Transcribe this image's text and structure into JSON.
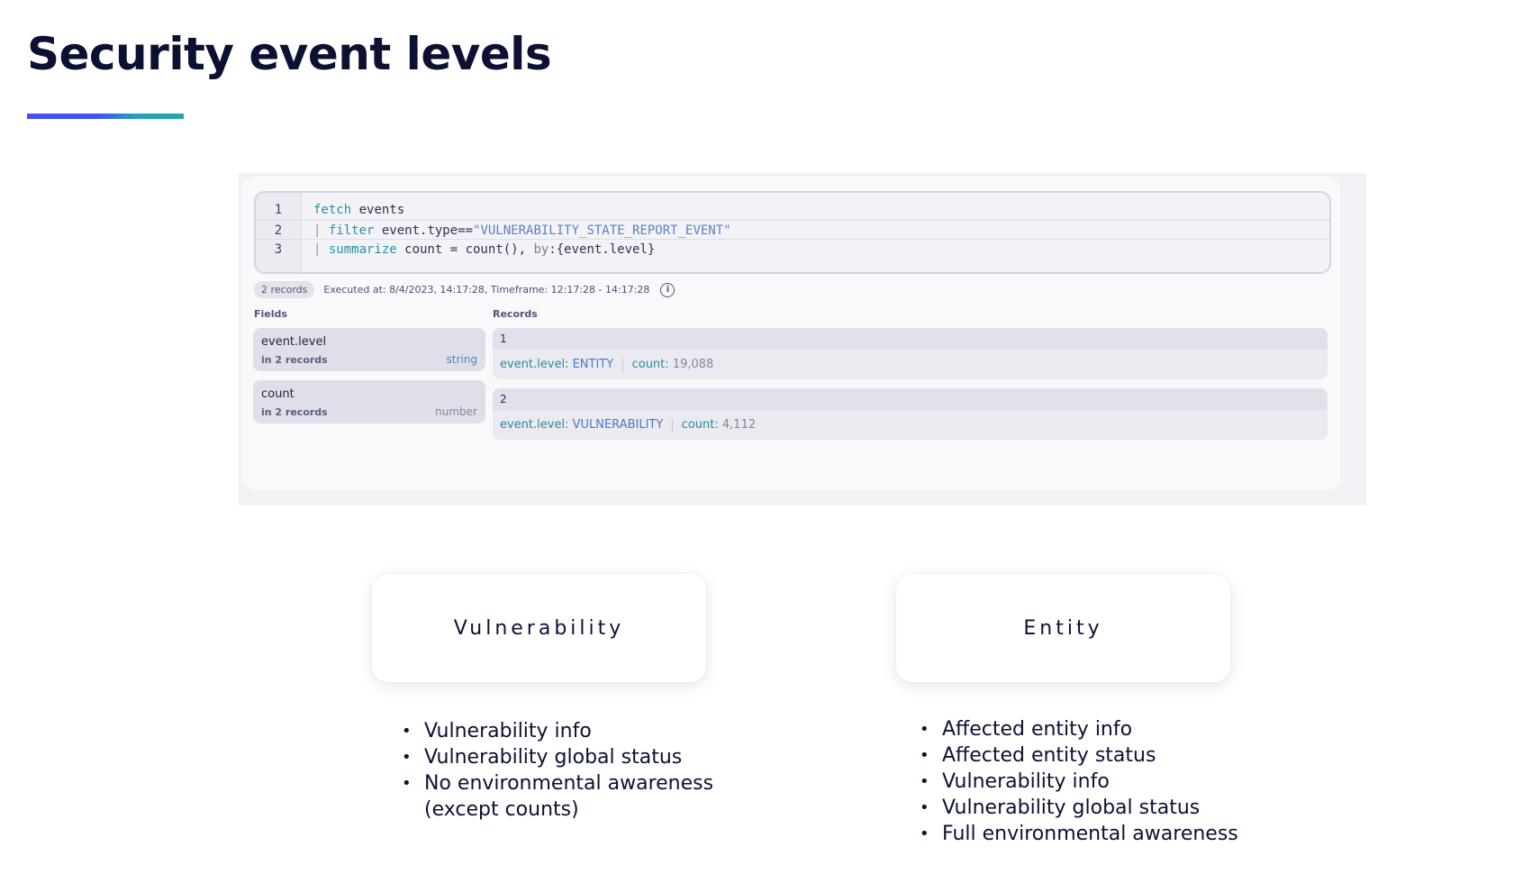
{
  "slide": {
    "title": "Security event levels",
    "accent_colors": {
      "gradient_start": "#4650f0",
      "gradient_end": "#22a6b1"
    }
  },
  "query_panel": {
    "code_lines": [
      {
        "number": "1",
        "tokens": [
          {
            "t": "fetch",
            "c": "kw"
          },
          {
            "t": " events",
            "c": ""
          }
        ]
      },
      {
        "number": "2",
        "tokens": [
          {
            "t": "| ",
            "c": "pipe"
          },
          {
            "t": "filter",
            "c": "kw"
          },
          {
            "t": " event.type==",
            "c": ""
          },
          {
            "t": "\"VULNERABILITY_STATE_REPORT_EVENT\"",
            "c": "str"
          }
        ]
      },
      {
        "number": "3",
        "tokens": [
          {
            "t": "| ",
            "c": "pipe"
          },
          {
            "t": "summarize",
            "c": "kw"
          },
          {
            "t": " count = count(), ",
            "c": ""
          },
          {
            "t": "by",
            "c": "muted"
          },
          {
            "t": ":{event.level}",
            "c": ""
          }
        ]
      }
    ],
    "records_badge": "2 records",
    "executed_text": "Executed at: 8/4/2023, 14:17:28, Timeframe: 12:17:28 - 14:17:28",
    "info_icon": "info-icon",
    "fields_label": "Fields",
    "records_label": "Records",
    "fields": [
      {
        "name": "event.level",
        "sub": "in 2 records",
        "type": "string",
        "type_color": "#5a80c8"
      },
      {
        "name": "count",
        "sub": "in 2 records",
        "type": "number",
        "type_color": "#8d7f9f"
      }
    ],
    "records": [
      {
        "index": "1",
        "key1": "event.level:",
        "val1": "ENTITY",
        "key2": "count:",
        "val2": "19,088"
      },
      {
        "index": "2",
        "key1": "event.level:",
        "val1": "VULNERABILITY",
        "key2": "count:",
        "val2": "4,112"
      }
    ]
  },
  "levels": [
    {
      "label": "Vulnerability",
      "bullets": [
        "Vulnerability info",
        "Vulnerability global status",
        "No environmental awareness",
        "(except counts)"
      ]
    },
    {
      "label": "Entity",
      "bullets": [
        "Affected entity info",
        "Affected entity status",
        "Vulnerability info",
        "Vulnerability global status",
        "Full environmental awareness"
      ]
    }
  ]
}
